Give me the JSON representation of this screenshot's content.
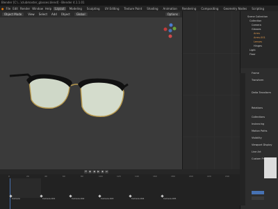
{
  "title_bar": {
    "text": "Blender [C:\\...\\clubmaster_glasses.blend] - Blender 4.1.1.01"
  },
  "menu": {
    "items": [
      "File",
      "Edit",
      "Render",
      "Window",
      "Help"
    ],
    "tabs": [
      "Layout",
      "Modeling",
      "Sculpting",
      "UV Editing",
      "Texture Paint",
      "Shading",
      "Animation",
      "Rendering",
      "Compositing",
      "Geometry Nodes",
      "Scripting"
    ],
    "active_tab": "Layout"
  },
  "viewport_header": {
    "mode": "Object Mode",
    "view": "View",
    "select": "Select",
    "add": "Add",
    "object": "Object",
    "transform": "Global",
    "options": "Options"
  },
  "outliner": {
    "rows": [
      "Scene Collection",
      "Collection",
      "Camera",
      "Glasses",
      "Arms",
      "Arms.001",
      "Lenses",
      "Hinges",
      "Light",
      "Floor"
    ]
  },
  "properties": {
    "object_name": "Frame",
    "sections": [
      "Transform",
      "Delta Transform",
      "Relations",
      "Collections",
      "Instancing",
      "Motion Paths",
      "Visibility",
      "Viewport Display",
      "Line Art",
      "Custom Properties"
    ]
  },
  "timeline": {
    "ruler": [
      "0",
      "20",
      "40",
      "60",
      "80",
      "100",
      "120",
      "140",
      "160",
      "180",
      "200",
      "220",
      "240"
    ],
    "markers": [
      "Camera",
      "Camera.001",
      "Camera.002",
      "Camera.003",
      "Camera.004",
      "Camera.005"
    ],
    "playback_icons": [
      "jump-start-icon",
      "prev-key-icon",
      "play-reverse-icon",
      "play-icon",
      "next-key-icon",
      "jump-end-icon"
    ]
  },
  "colors": {
    "accent": "#4772b3",
    "frame_black": "#111111",
    "gold": "#b89a4f",
    "lens": "#cfd8c8"
  }
}
